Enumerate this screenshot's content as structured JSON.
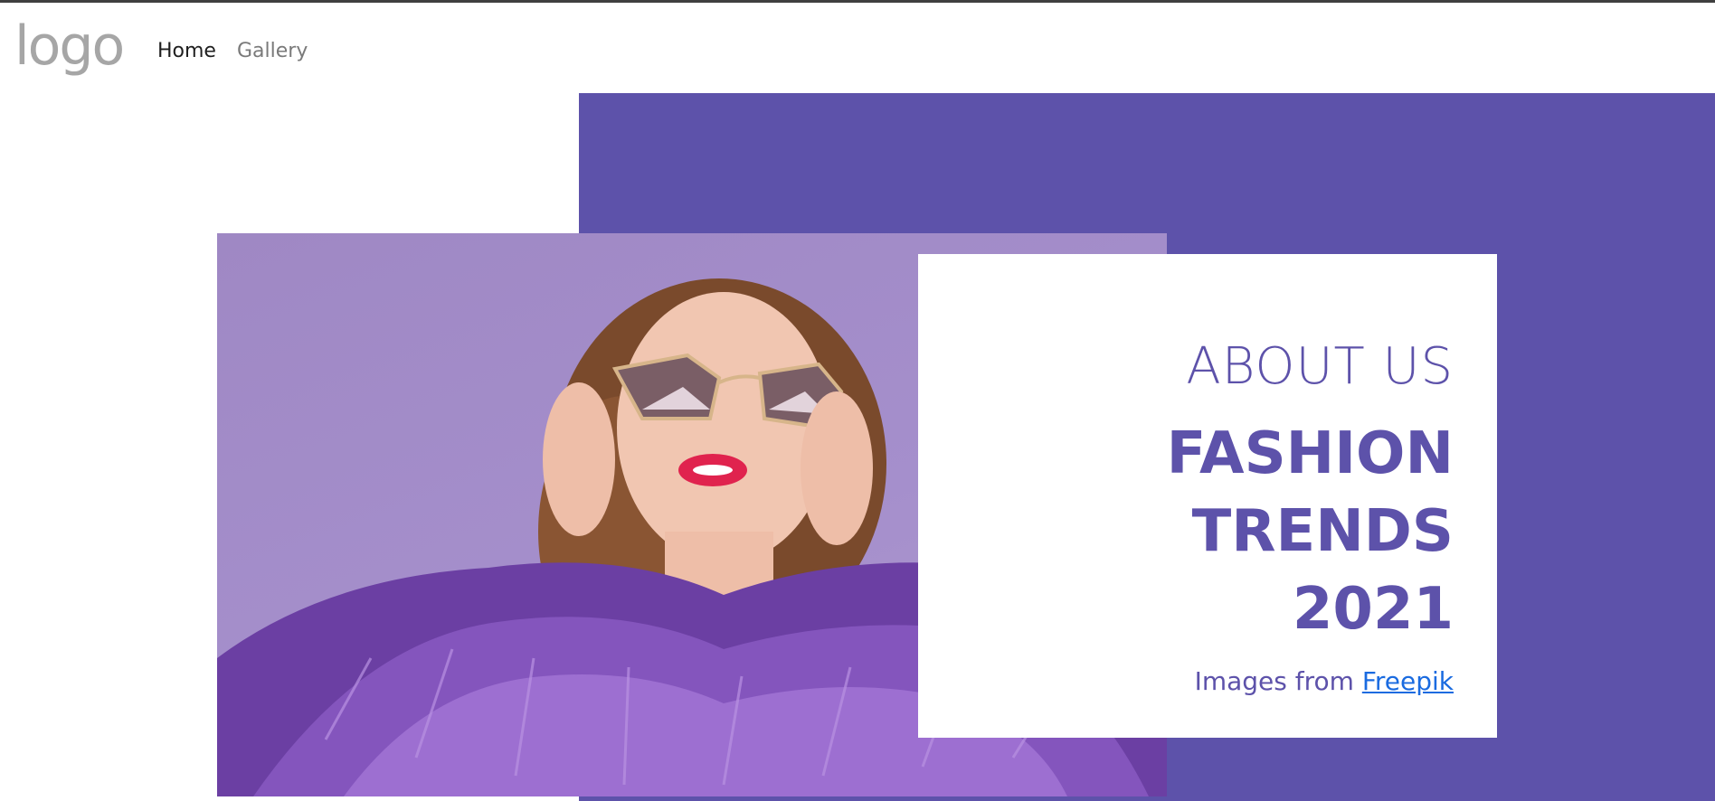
{
  "navbar": {
    "logo_text": "logo",
    "links": [
      {
        "label": "Home"
      },
      {
        "label": "Gallery"
      }
    ]
  },
  "hero": {
    "eyebrow": "ABOUT US",
    "title_lines": [
      "FASHION",
      "TRENDS",
      "2021"
    ],
    "credit_prefix": "Images from",
    "credit_link": "Freepik"
  },
  "colors": {
    "brand_purple": "#5d52aa",
    "link_blue": "#1a6be0",
    "logo_gray": "#a6a6a6"
  }
}
